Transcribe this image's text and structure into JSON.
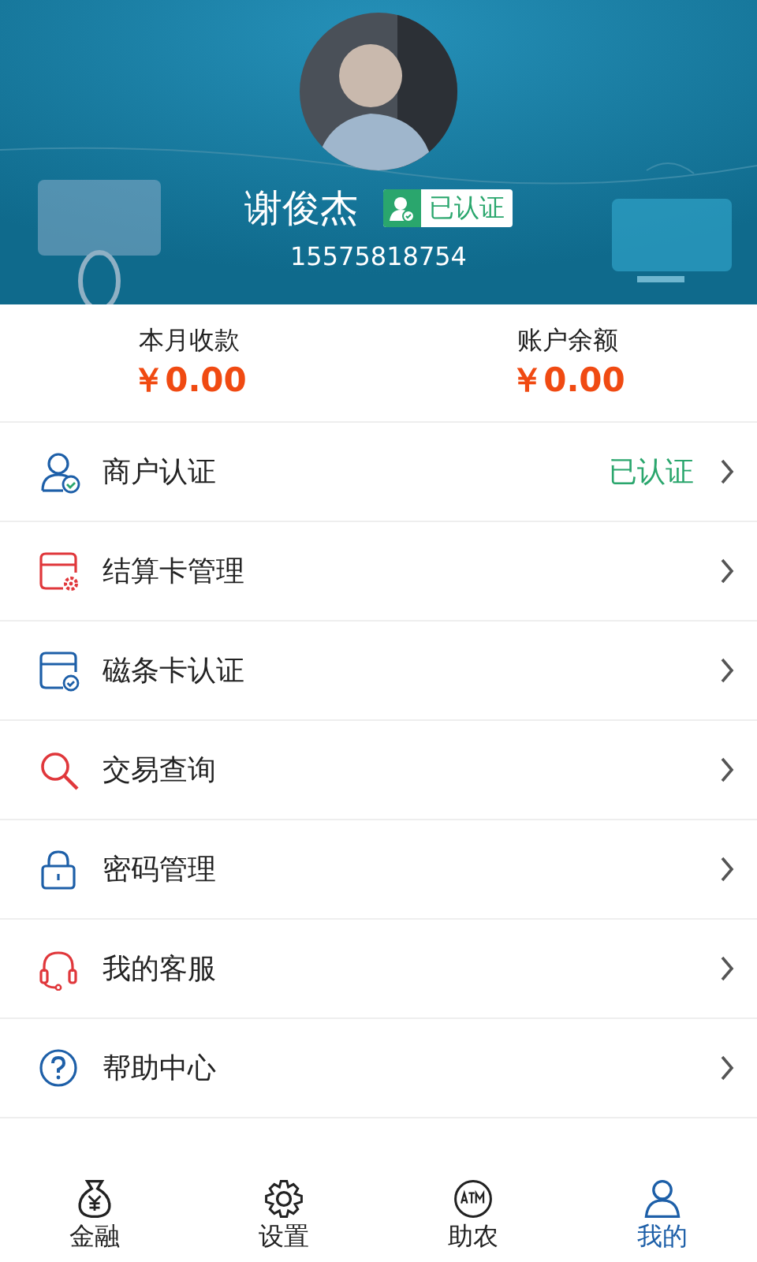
{
  "profile": {
    "name": "谢俊杰",
    "verified_badge": "已认证",
    "phone": "15575818754"
  },
  "summary": [
    {
      "label": "本月收款",
      "amount": "￥0.00"
    },
    {
      "label": "账户余额",
      "amount": "￥0.00"
    }
  ],
  "menu": [
    {
      "kind": "merchant",
      "label": "商户认证",
      "status": "已认证"
    },
    {
      "kind": "settlement",
      "label": "结算卡管理"
    },
    {
      "kind": "stripe",
      "label": "磁条卡认证"
    },
    {
      "kind": "query",
      "label": "交易查询"
    },
    {
      "kind": "password",
      "label": "密码管理"
    },
    {
      "kind": "service",
      "label": "我的客服"
    },
    {
      "kind": "help",
      "label": "帮助中心"
    }
  ],
  "bottom_nav": [
    {
      "kind": "finance",
      "label": "金融",
      "selected": false
    },
    {
      "kind": "settings",
      "label": "设置",
      "selected": false
    },
    {
      "kind": "agri",
      "label": "助农",
      "selected": false
    },
    {
      "kind": "mine",
      "label": "我的",
      "selected": true
    }
  ]
}
